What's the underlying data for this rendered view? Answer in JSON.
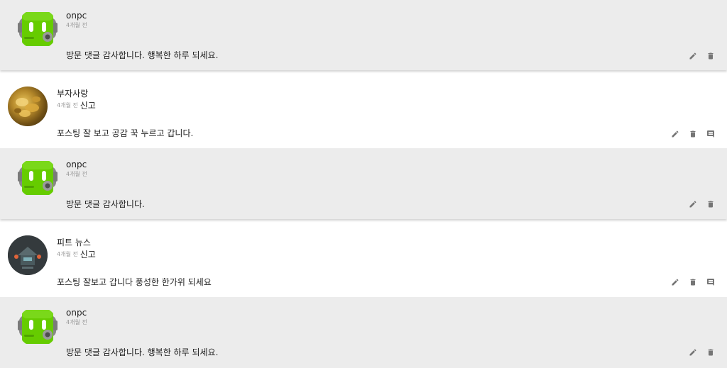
{
  "comments": [
    {
      "author": "onpc",
      "time": "4개월 전",
      "text": "방문 댓글 감사합니다. 행복한 하루 되세요.",
      "avatar": "green-robot-avatar",
      "is_reply": true
    },
    {
      "author": "부자사랑",
      "time": "4개월 전",
      "report_label": "신고",
      "text": "포스팅 잘 보고 공감 꾹 누르고 갑니다.",
      "avatar": "gold-coins-avatar",
      "is_reply": false
    },
    {
      "author": "onpc",
      "time": "4개월 전",
      "text": "방문 댓글 감사합니다.",
      "avatar": "green-robot-avatar",
      "is_reply": true
    },
    {
      "author": "피트 뉴스",
      "time": "4개월 전",
      "report_label": "신고",
      "text": "포스팅 잘보고 갑니다 풍성한 한가위 되세요",
      "avatar": "dark-house-avatar",
      "is_reply": false
    },
    {
      "author": "onpc",
      "time": "4개월 전",
      "text": "방문 댓글 감사합니다. 행복한 하루 되세요.",
      "avatar": "green-robot-avatar",
      "is_reply": true
    }
  ],
  "icons": {
    "edit": "pencil-icon",
    "delete": "trash-icon",
    "reply": "comment-icon"
  },
  "colors": {
    "reply_bg": "#ececec",
    "robot_green": "#66cc00",
    "icon_gray": "#757575"
  }
}
